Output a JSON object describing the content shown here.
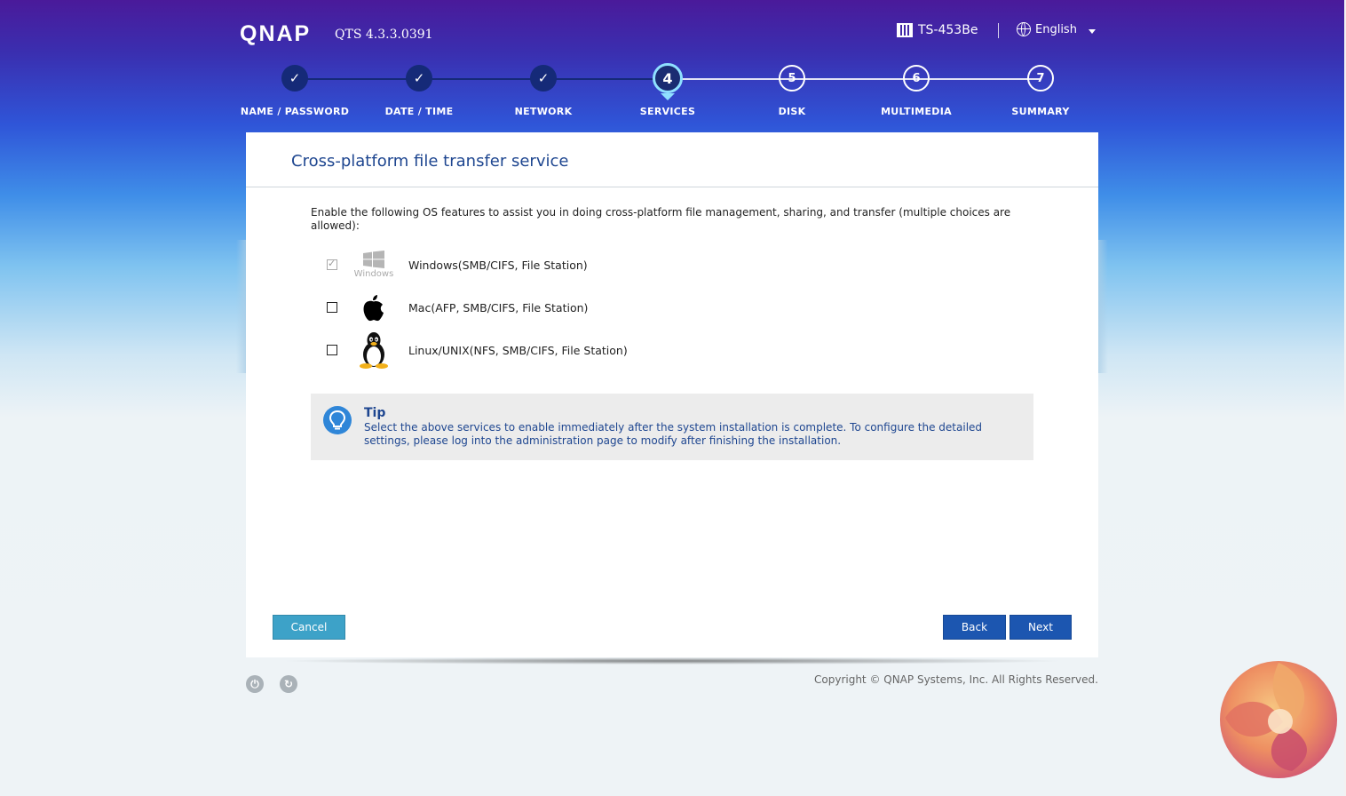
{
  "header": {
    "logo": "QNAP",
    "version": "QTS 4.3.3.0391",
    "model": "TS-453Be",
    "language": "English"
  },
  "steps": [
    {
      "number": "1",
      "label": "NAME / PASSWORD",
      "status": "done"
    },
    {
      "number": "2",
      "label": "DATE / TIME",
      "status": "done"
    },
    {
      "number": "3",
      "label": "NETWORK",
      "status": "done"
    },
    {
      "number": "4",
      "label": "SERVICES",
      "status": "current"
    },
    {
      "number": "5",
      "label": "DISK",
      "status": "todo"
    },
    {
      "number": "6",
      "label": "MULTIMEDIA",
      "status": "todo"
    },
    {
      "number": "7",
      "label": "SUMMARY",
      "status": "todo"
    }
  ],
  "panel": {
    "title": "Cross-platform file transfer service",
    "description": "Enable the following OS features to assist you in doing cross-platform file management, sharing, and transfer (multiple choices are allowed):",
    "options": [
      {
        "label": "Windows(SMB/CIFS, File Station)",
        "icon": "windows-icon",
        "icon_caption": "Windows",
        "checked": true,
        "disabled": true
      },
      {
        "label": "Mac(AFP, SMB/CIFS, File Station)",
        "icon": "apple-icon",
        "checked": false
      },
      {
        "label": "Linux/UNIX(NFS, SMB/CIFS, File Station)",
        "icon": "tux-icon",
        "checked": false
      }
    ],
    "tip": {
      "title": "Tip",
      "text": "Select the above services to enable immediately after the system installation is complete. To configure the detailed settings, please log into the administration page to modify after finishing the installation."
    }
  },
  "buttons": {
    "cancel": "Cancel",
    "back": "Back",
    "next": "Next"
  },
  "footer": {
    "copyright": "Copyright © QNAP Systems, Inc. All Rights Reserved."
  },
  "colors": {
    "accent": "#1c56b0",
    "cancel": "#3da2c8",
    "title": "#1e4690"
  }
}
